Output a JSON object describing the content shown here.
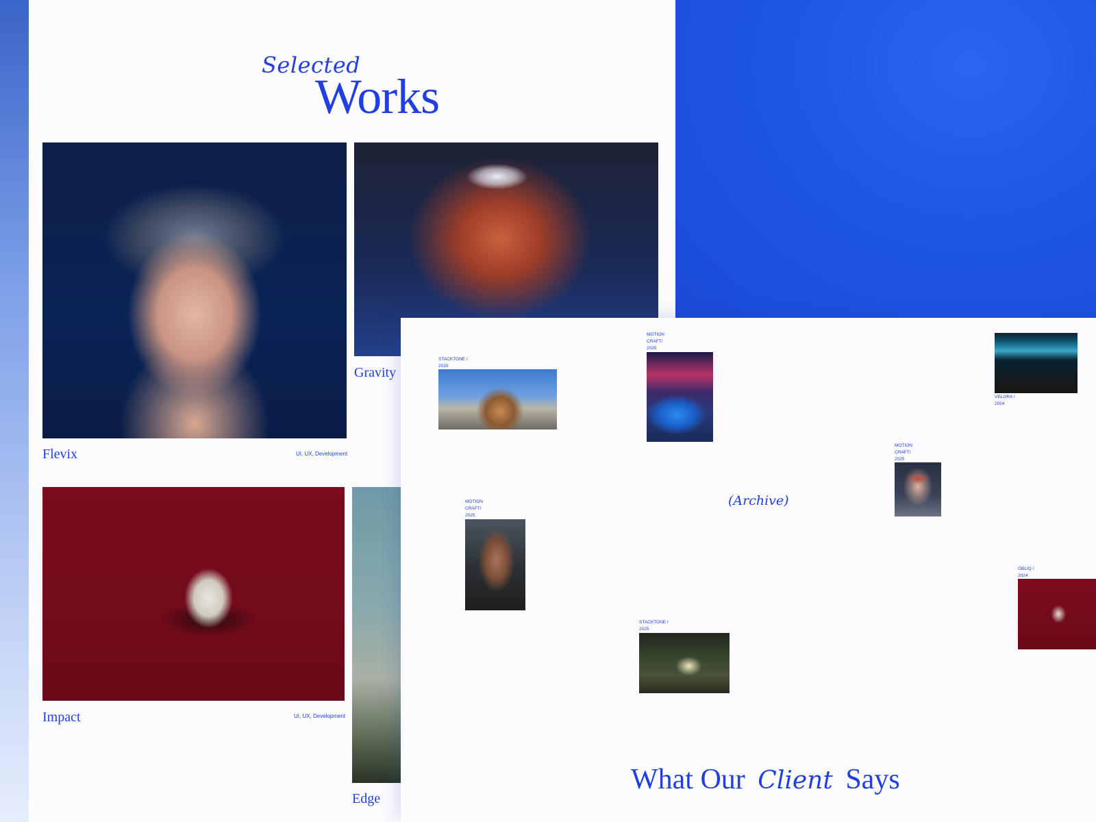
{
  "heading": {
    "script": "Selected",
    "main": "Works"
  },
  "works": [
    {
      "title": "Flevix",
      "tags": "UI, UX, Development"
    },
    {
      "title": "Gravity",
      "tags": ""
    },
    {
      "title": "Impact",
      "tags": "UI, UX, Development"
    },
    {
      "title": "Edge",
      "tags": ""
    }
  ],
  "archive": {
    "label": "(Archive)",
    "items": [
      {
        "label": "STACKTONE /\n2025"
      },
      {
        "label": "MOTION\nCRAFT/\n2025"
      },
      {
        "label": "VELORA /\n2024"
      },
      {
        "label": "MOTION\nCRAFT/\n2025"
      },
      {
        "label": "MOTION\nCRAFT/\n2025"
      },
      {
        "label": "OBLIQ /\n2024"
      },
      {
        "label": "STACKTONE /\n2025"
      }
    ]
  },
  "clients": {
    "pre": "What Our",
    "script": "Client",
    "post": "Says"
  },
  "colors": {
    "accent": "#1f3fe0",
    "background_blue": "#1f57e6",
    "panel": "#fcfcfe"
  }
}
